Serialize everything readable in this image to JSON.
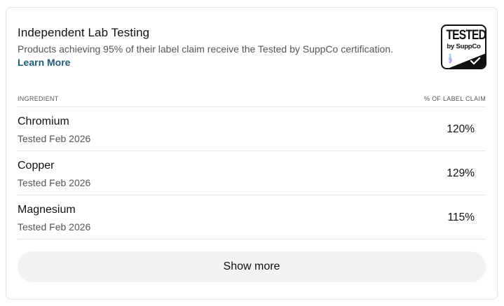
{
  "section": {
    "title": "Independent Lab Testing",
    "subtitle": "Products achieving 95% of their label claim receive the Tested by SuppCo certification.",
    "learn_more_label": "Learn More"
  },
  "badge": {
    "line1": "TESTED",
    "line2": "by SuppCo",
    "check_icon": "checkmark-icon",
    "accent_colors": [
      "#a8d4f2",
      "#c9a3f0",
      "#111111"
    ]
  },
  "table": {
    "headers": {
      "ingredient": "INGREDIENT",
      "claim": "% OF LABEL CLAIM"
    },
    "rows": [
      {
        "name": "Chromium",
        "tested": "Tested Feb 2026",
        "percent": "120%"
      },
      {
        "name": "Copper",
        "tested": "Tested Feb 2026",
        "percent": "129%"
      },
      {
        "name": "Magnesium",
        "tested": "Tested Feb 2026",
        "percent": "115%"
      }
    ]
  },
  "actions": {
    "show_more_label": "Show more"
  },
  "colors": {
    "link": "#1d5a73",
    "muted_text": "#555555",
    "button_bg": "#f2f2f2"
  }
}
